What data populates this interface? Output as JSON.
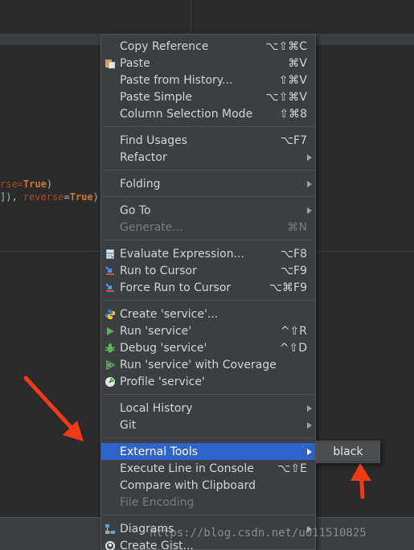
{
  "editor": {
    "code_line_1": {
      "part1": "rse=",
      "part2": "True",
      "part3": ")"
    },
    "code_line_2": {
      "part1": "]), ",
      "part2": "reverse",
      "part3": "=",
      "part4": "True",
      "part5": ")"
    }
  },
  "menu": {
    "items": [
      {
        "label": "Copy Reference",
        "shortcut": "⌥⇧⌘C",
        "icon": ""
      },
      {
        "label": "Paste",
        "shortcut": "⌘V",
        "icon": "paste-icon"
      },
      {
        "label": "Paste from History...",
        "shortcut": "⇧⌘V",
        "icon": ""
      },
      {
        "label": "Paste Simple",
        "shortcut": "⌥⇧⌘V",
        "icon": ""
      },
      {
        "label": "Column Selection Mode",
        "shortcut": "⇧⌘8",
        "icon": ""
      },
      {
        "label": "Find Usages",
        "shortcut": "⌥F7",
        "icon": ""
      },
      {
        "label": "Refactor",
        "shortcut": "",
        "icon": ""
      },
      {
        "label": "Folding",
        "shortcut": "",
        "icon": ""
      },
      {
        "label": "Go To",
        "shortcut": "",
        "icon": ""
      },
      {
        "label": "Generate...",
        "shortcut": "⌘N",
        "icon": ""
      },
      {
        "label": "Evaluate Expression...",
        "shortcut": "⌥F8",
        "icon": "calculator-icon"
      },
      {
        "label": "Run to Cursor",
        "shortcut": "⌥F9",
        "icon": "run-to-cursor-icon"
      },
      {
        "label": "Force Run to Cursor",
        "shortcut": "⌥⌘F9",
        "icon": "force-run-to-cursor-icon"
      },
      {
        "label": "Create 'service'...",
        "shortcut": "",
        "icon": "python-icon"
      },
      {
        "label": "Run 'service'",
        "shortcut": "^⇧R",
        "icon": "run-icon"
      },
      {
        "label": "Debug 'service'",
        "shortcut": "^⇧D",
        "icon": "debug-icon"
      },
      {
        "label": "Run 'service' with Coverage",
        "shortcut": "",
        "icon": "coverage-icon"
      },
      {
        "label": "Profile 'service'",
        "shortcut": "",
        "icon": "profile-icon"
      },
      {
        "label": "Local History",
        "shortcut": "",
        "icon": ""
      },
      {
        "label": "Git",
        "shortcut": "",
        "icon": ""
      },
      {
        "label": "External Tools",
        "shortcut": "",
        "icon": ""
      },
      {
        "label": "Execute Line in Console",
        "shortcut": "⌥⇧E",
        "icon": ""
      },
      {
        "label": "Compare with Clipboard",
        "shortcut": "",
        "icon": ""
      },
      {
        "label": "File Encoding",
        "shortcut": "",
        "icon": ""
      },
      {
        "label": "Diagrams",
        "shortcut": "",
        "icon": "diagrams-icon"
      },
      {
        "label": "Create Gist...",
        "shortcut": "",
        "icon": "github-icon"
      }
    ]
  },
  "submenu": {
    "items": [
      {
        "label": "black"
      }
    ]
  },
  "watermark": "https://blog.csdn.net/u011510825",
  "colors": {
    "menu_bg": "#3c3f41",
    "highlight": "#2f65ca",
    "annotation_arrow": "#f03a17"
  }
}
